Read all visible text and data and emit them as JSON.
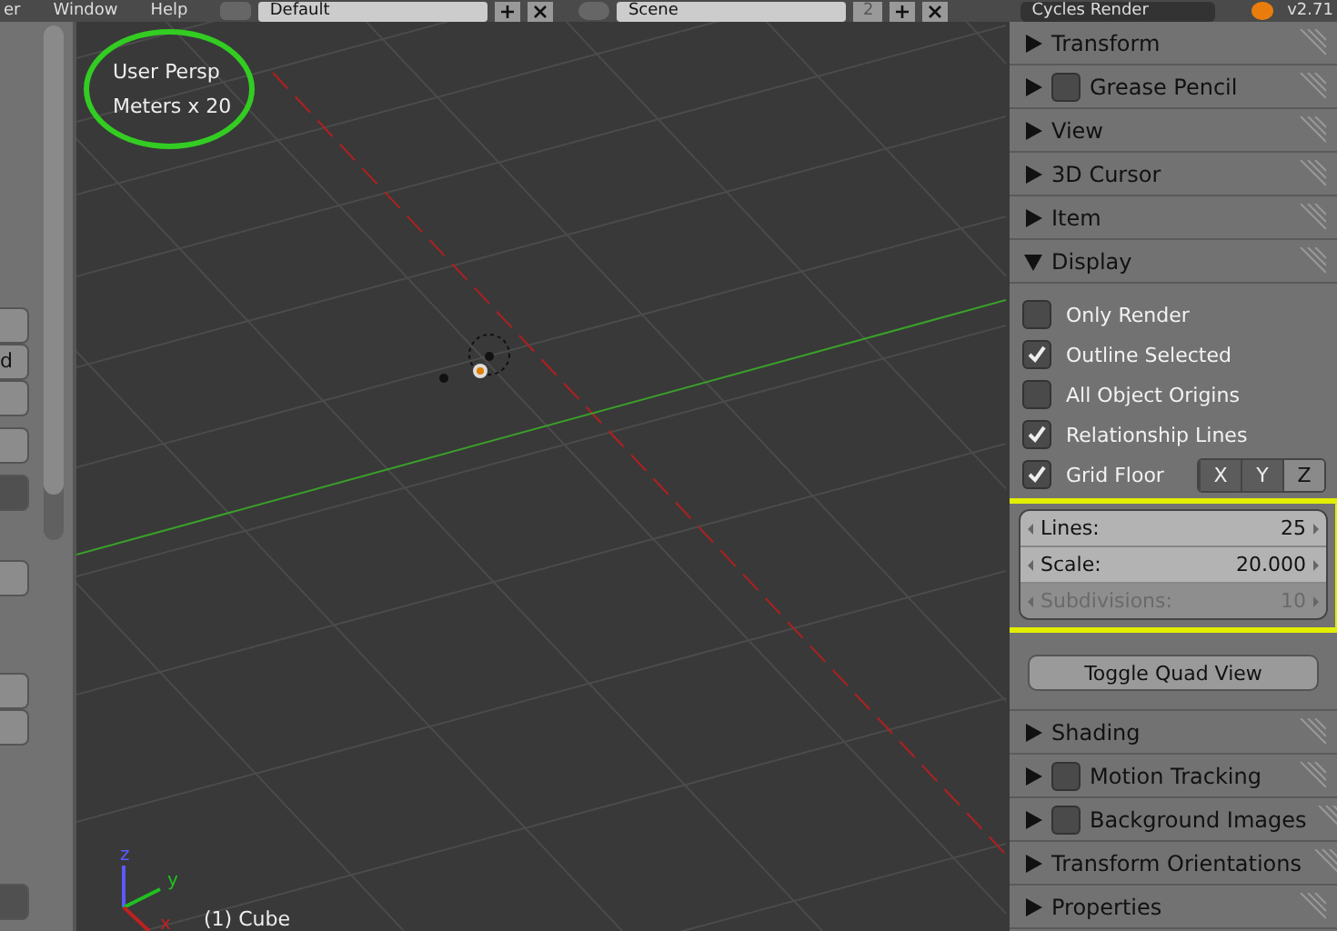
{
  "menu": [
    "er",
    "Window",
    "Help"
  ],
  "layout": {
    "name": "Default"
  },
  "scene": {
    "name": "Scene",
    "users": "2"
  },
  "render_engine": "Cycles Render",
  "version": "v2.71",
  "toolbar": {
    "cut_label": "d"
  },
  "viewport": {
    "view_name": "User Persp",
    "scale_label": "Meters x 20",
    "object_label": "(1) Cube",
    "gizmo_axes": [
      {
        "label": "z",
        "color": "#5a5aff"
      },
      {
        "label": "y",
        "color": "#20c020"
      },
      {
        "label": "x",
        "color": "#c02020"
      }
    ]
  },
  "panels": [
    {
      "title": "Transform",
      "expanded": false,
      "kind": "plain"
    },
    {
      "title": "Grease Pencil",
      "expanded": false,
      "kind": "toggle",
      "checked": false
    },
    {
      "title": "View",
      "expanded": false,
      "kind": "plain"
    },
    {
      "title": "3D Cursor",
      "expanded": false,
      "kind": "plain"
    },
    {
      "title": "Item",
      "expanded": false,
      "kind": "plain"
    },
    {
      "title": "Display",
      "expanded": true,
      "kind": "plain"
    }
  ],
  "display": {
    "options": [
      {
        "label": "Only Render",
        "checked": false
      },
      {
        "label": "Outline Selected",
        "checked": true
      },
      {
        "label": "All Object Origins",
        "checked": false
      },
      {
        "label": "Relationship Lines",
        "checked": true
      }
    ],
    "grid_floor": {
      "label": "Grid Floor",
      "checked": true
    },
    "grid_axes": [
      {
        "label": "X",
        "selected": false
      },
      {
        "label": "Y",
        "selected": false
      },
      {
        "label": "Z",
        "selected": true
      }
    ],
    "fields": [
      {
        "label": "Lines:",
        "value": "25",
        "disabled": false
      },
      {
        "label": "Scale:",
        "value": "20.000",
        "disabled": false
      },
      {
        "label": "Subdivisions:",
        "value": "10",
        "disabled": true
      }
    ],
    "button": "Toggle Quad View"
  },
  "lower_panels": [
    {
      "title": "Shading",
      "expanded": false,
      "kind": "plain"
    },
    {
      "title": "Motion Tracking",
      "expanded": false,
      "kind": "toggle",
      "checked": false
    },
    {
      "title": "Background Images",
      "expanded": false,
      "kind": "toggle",
      "checked": false
    },
    {
      "title": "Transform Orientations",
      "expanded": false,
      "kind": "plain"
    },
    {
      "title": "Properties",
      "expanded": false,
      "kind": "plain"
    }
  ]
}
